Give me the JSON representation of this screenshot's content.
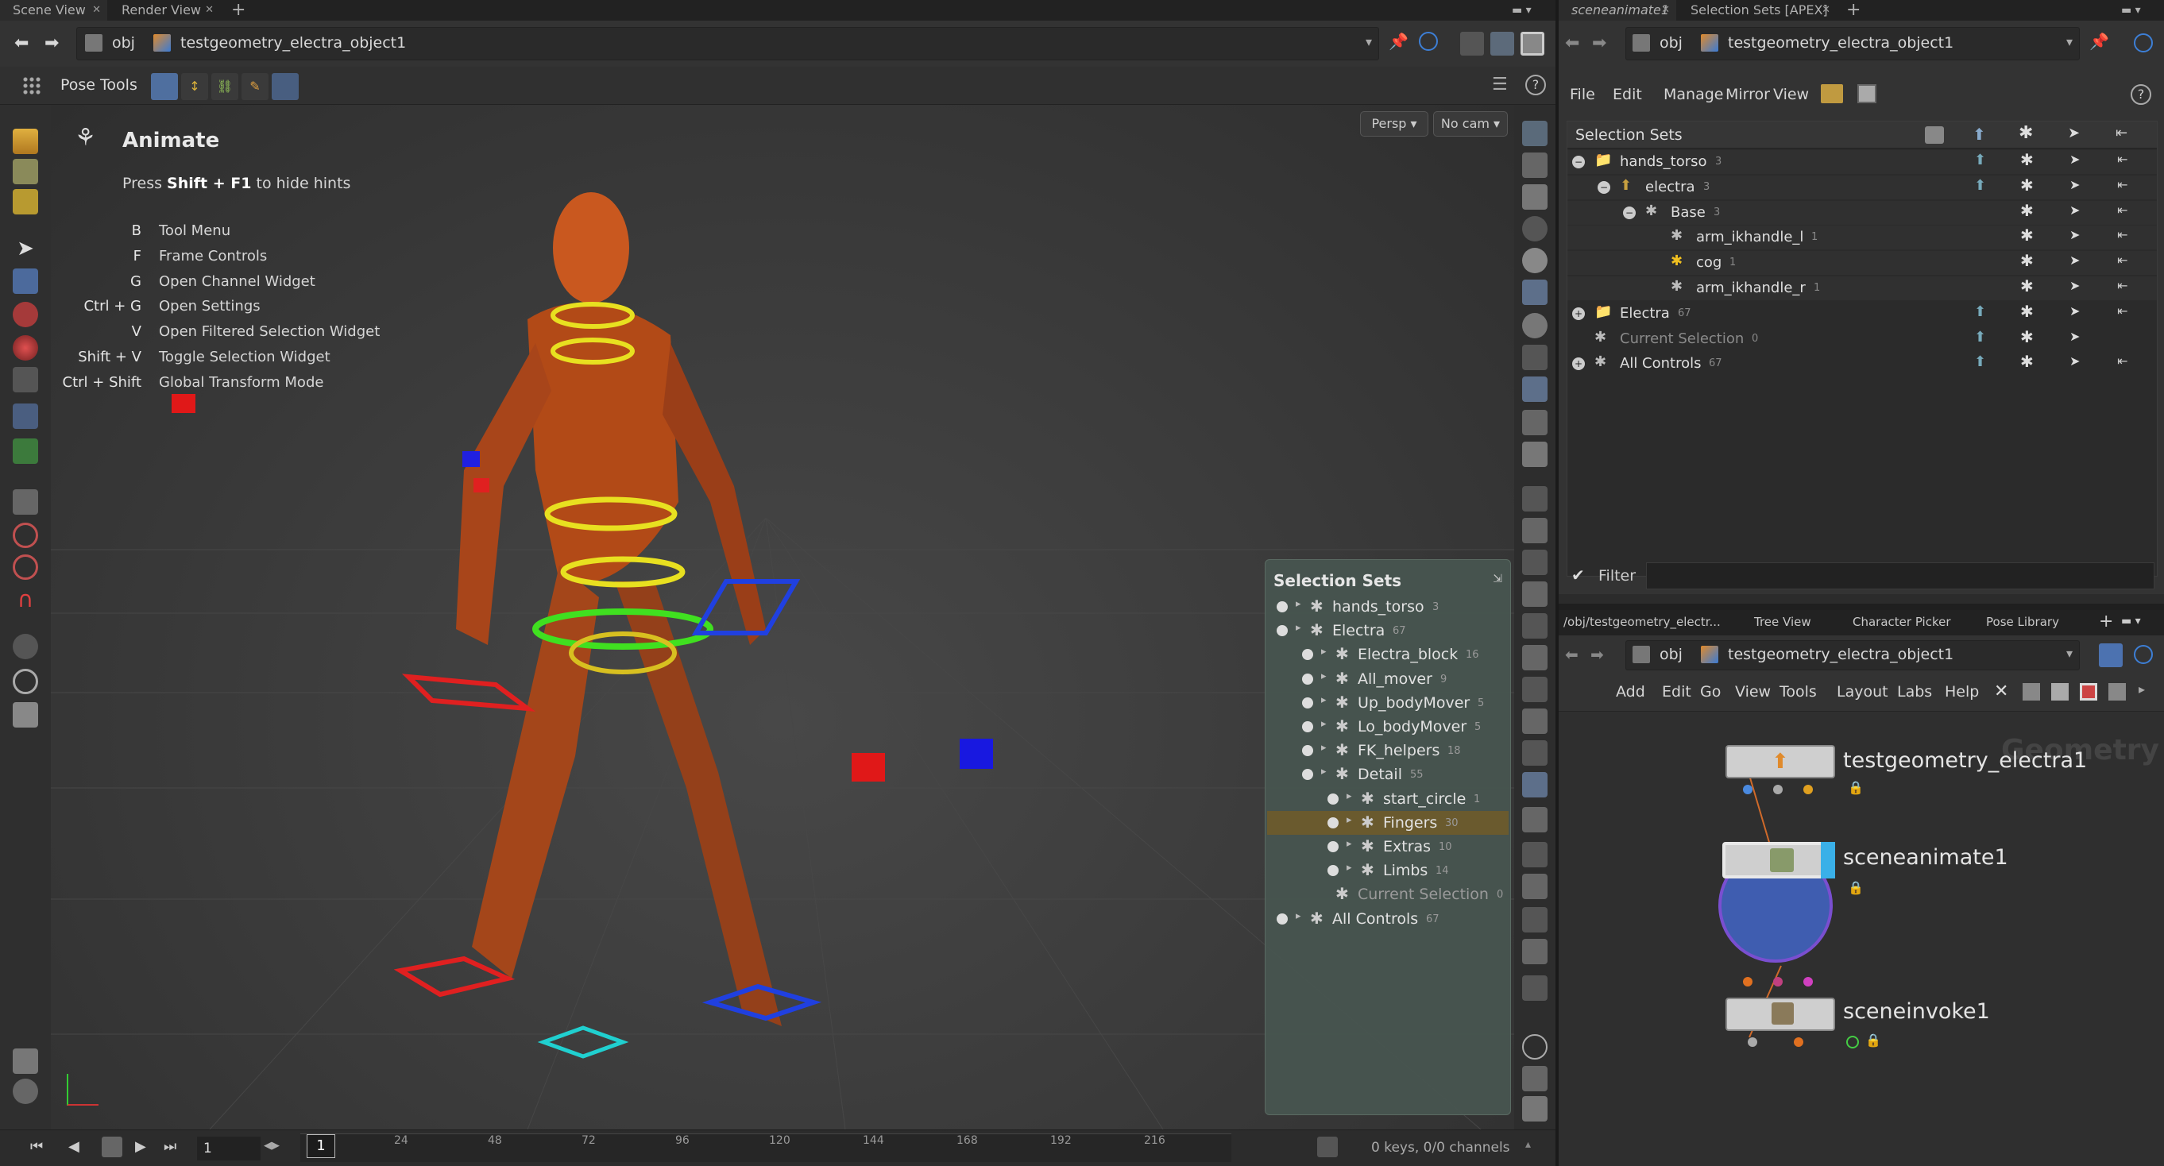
{
  "colors": {
    "bg": "#2b2b2b",
    "panel": "#333333",
    "viewport": "#3b3b3b",
    "accent": "#4c7fd0",
    "highlight": "#6a5a2e"
  },
  "left_tabs": [
    "Scene View",
    "Render View"
  ],
  "right_top_tabs": [
    "sceneanimate1",
    "Selection Sets [APEX]"
  ],
  "left_path": {
    "root": "obj",
    "node": "testgeometry_electra_object1"
  },
  "right_path": {
    "root": "obj",
    "node": "testgeometry_electra_object1"
  },
  "pose_tools_label": "Pose Tools",
  "viewport": {
    "persp_btn": "Persp ▾",
    "cam_btn": "No cam ▾",
    "hint_title": "Animate",
    "hint_press_prefix": "Press ",
    "hint_press_key": "Shift + F1",
    "hint_press_suffix": " to hide hints",
    "hints": [
      {
        "key": "B",
        "label": "Tool Menu"
      },
      {
        "key": "F",
        "label": "Frame Controls"
      },
      {
        "key": "G",
        "label": "Open Channel Widget"
      },
      {
        "key": "Ctrl + G",
        "label": "Open Settings"
      },
      {
        "key": "V",
        "label": "Open Filtered Selection Widget"
      },
      {
        "key": "Shift + V",
        "label": "Toggle Selection Widget"
      },
      {
        "key": "Ctrl + Shift",
        "label": "Global Transform Mode"
      }
    ]
  },
  "overlay_sets": {
    "title": "Selection Sets",
    "rows": [
      {
        "name": "hands_torso",
        "count": "3"
      },
      {
        "name": "Electra",
        "count": "67"
      },
      {
        "name": "Electra_block",
        "count": "16"
      },
      {
        "name": "All_mover",
        "count": "9"
      },
      {
        "name": "Up_bodyMover",
        "count": "5"
      },
      {
        "name": "Lo_bodyMover",
        "count": "5"
      },
      {
        "name": "FK_helpers",
        "count": "18"
      },
      {
        "name": "Detail",
        "count": "55"
      },
      {
        "name": "start_circle",
        "count": "1"
      },
      {
        "name": "Fingers",
        "count": "30"
      },
      {
        "name": "Extras",
        "count": "10"
      },
      {
        "name": "Limbs",
        "count": "14"
      },
      {
        "name": "Current Selection",
        "count": "0"
      },
      {
        "name": "All Controls",
        "count": "67"
      }
    ]
  },
  "timeline": {
    "frame": "1",
    "current": "1",
    "ticks": [
      "24",
      "48",
      "72",
      "96",
      "120",
      "144",
      "168",
      "192",
      "216"
    ],
    "status": "0 keys, 0/0 channels"
  },
  "sel_panel": {
    "menu": [
      "File",
      "Edit",
      "Manage",
      "Mirror",
      "View"
    ],
    "header": "Selection Sets",
    "rows": [
      {
        "name": "hands_torso",
        "count": "3"
      },
      {
        "name": "electra",
        "count": "3"
      },
      {
        "name": "Base",
        "count": "3"
      },
      {
        "name": "arm_ikhandle_l",
        "count": "1"
      },
      {
        "name": "cog",
        "count": "1"
      },
      {
        "name": "arm_ikhandle_r",
        "count": "1"
      },
      {
        "name": "Electra",
        "count": "67"
      },
      {
        "name": "Current Selection",
        "count": "0"
      },
      {
        "name": "All Controls",
        "count": "67"
      }
    ],
    "filter_label": "Filter"
  },
  "net_tabs": [
    "/obj/testgeometry_electr...",
    "Tree View",
    "Character Picker",
    "Pose Library"
  ],
  "net_menu": [
    "Add",
    "Edit",
    "Go",
    "View",
    "Tools",
    "Layout",
    "Labs",
    "Help"
  ],
  "net_watermark": "Geometry",
  "nodes": [
    "testgeometry_electra1",
    "sceneanimate1",
    "sceneinvoke1"
  ]
}
